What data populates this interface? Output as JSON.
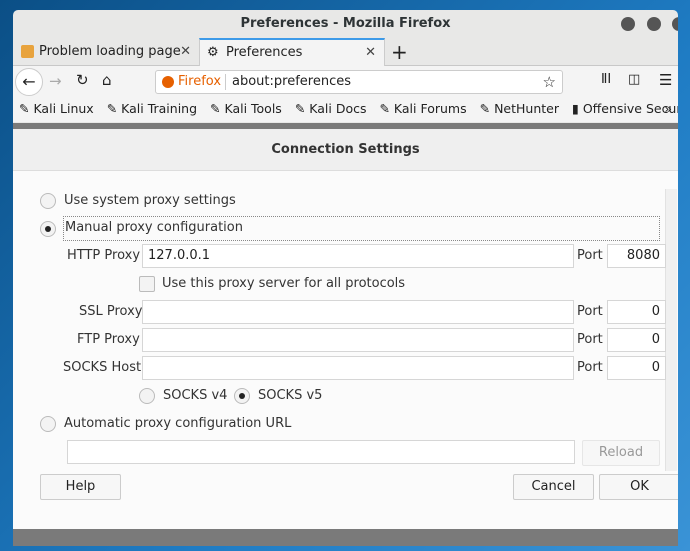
{
  "window": {
    "title": "Preferences - Mozilla Firefox"
  },
  "tabs": [
    {
      "label": "Problem loading page"
    },
    {
      "label": "Preferences"
    }
  ],
  "urlbar": {
    "identity": "Firefox",
    "url": "about:preferences"
  },
  "bookmarks": [
    "Kali Linux",
    "Kali Training",
    "Kali Tools",
    "Kali Docs",
    "Kali Forums",
    "NetHunter",
    "Offensive Security"
  ],
  "dialog": {
    "title": "Connection Settings",
    "options": {
      "system": "Use system proxy settings",
      "manual": "Manual proxy configuration",
      "auto": "Automatic proxy configuration URL"
    },
    "http": {
      "label": "HTTP Proxy",
      "value": "127.0.0.1",
      "port_label": "Port",
      "port": "8080"
    },
    "all_protocols": "Use this proxy server for all protocols",
    "ssl": {
      "label": "SSL Proxy",
      "value": "",
      "port_label": "Port",
      "port": "0"
    },
    "ftp": {
      "label": "FTP Proxy",
      "value": "",
      "port_label": "Port",
      "port": "0"
    },
    "socks": {
      "label": "SOCKS Host",
      "value": "",
      "port_label": "Port",
      "port": "0"
    },
    "socks_v4": "SOCKS v4",
    "socks_v5": "SOCKS v5",
    "auto_url": "",
    "reload": "Reload",
    "help": "Help",
    "cancel": "Cancel",
    "ok": "OK"
  },
  "colors": {
    "accent": "#3d9ae8",
    "firefox": "#e66000"
  }
}
